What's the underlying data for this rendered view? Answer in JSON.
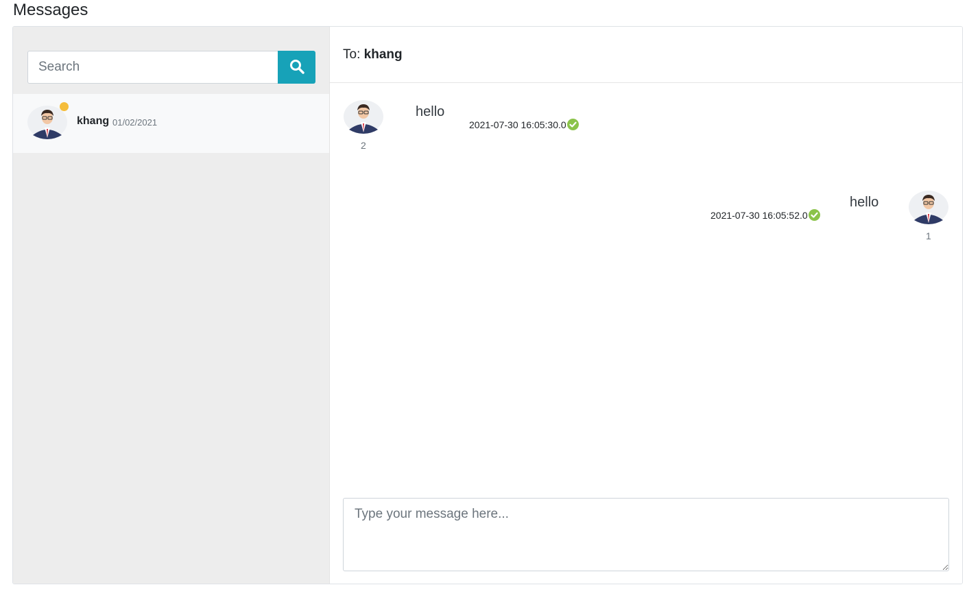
{
  "page": {
    "title": "Messages"
  },
  "sidebar": {
    "search": {
      "placeholder": "Search",
      "value": ""
    },
    "conversations": [
      {
        "name": "khang",
        "date": "01/02/2021",
        "status": "online"
      }
    ]
  },
  "chat": {
    "to_prefix": "To:",
    "to_name": "khang",
    "messages": [
      {
        "side": "left",
        "sender_id": "2",
        "text": "hello",
        "time": "2021-07-30 16:05:30.0",
        "read": true
      },
      {
        "side": "right",
        "sender_id": "1",
        "text": "hello",
        "time": "2021-07-30 16:05:52.0",
        "read": true
      }
    ],
    "composer": {
      "placeholder": "Type your message here...",
      "value": ""
    }
  },
  "colors": {
    "accent": "#17a2b8",
    "online": "#f5bd3b",
    "read_check": "#8bc34a",
    "sidebar_bg": "#ededed"
  },
  "icons": {
    "search": "search-icon",
    "read": "check-circle-icon",
    "avatar": "user-avatar-icon"
  }
}
